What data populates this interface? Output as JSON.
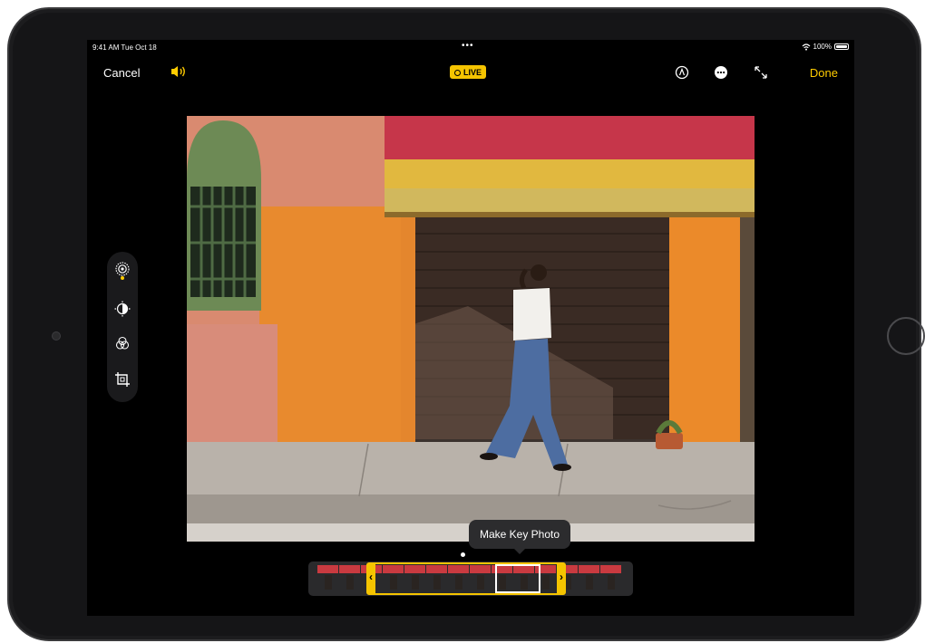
{
  "status_bar": {
    "time": "9:41 AM  Tue Oct 18",
    "dots": "•••",
    "battery": "100%"
  },
  "toolbar": {
    "cancel": "Cancel",
    "live": "LIVE",
    "done": "Done",
    "icons": [
      "speaker-icon",
      "markup-icon",
      "more-icon",
      "expand-icon"
    ]
  },
  "tools": {
    "items": [
      "live-photo-icon",
      "adjust-icon",
      "filters-icon",
      "crop-icon"
    ]
  },
  "frame_strip": {
    "tooltip": "Make Key Photo"
  },
  "colors": {
    "accent": "#f5c400",
    "background": "#000000",
    "device": "#1c1c1e"
  }
}
